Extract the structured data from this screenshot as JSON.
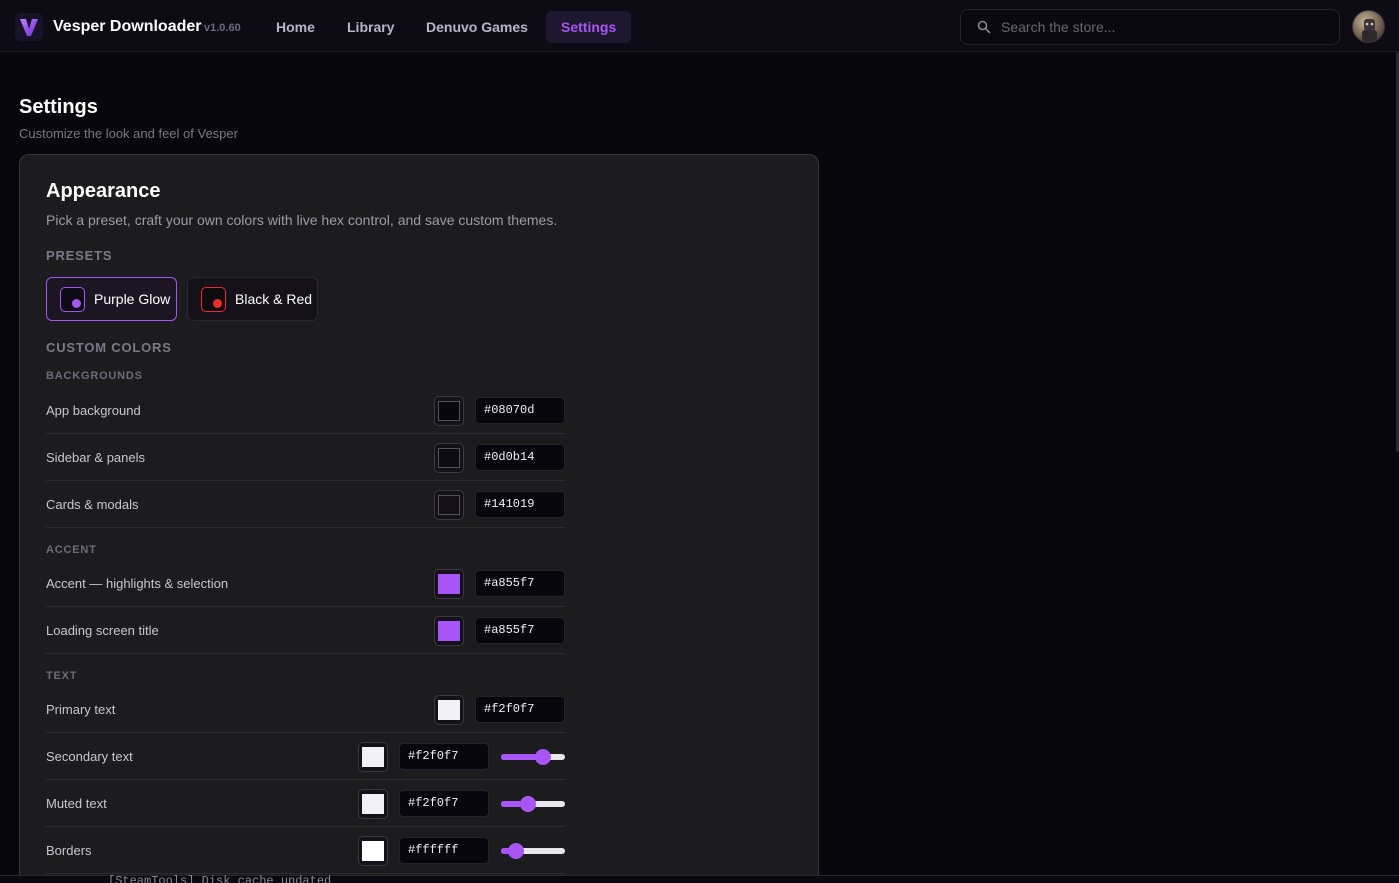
{
  "app": {
    "name": "Vesper Downloader",
    "version": "v1.0.60",
    "accent": "#a855f7"
  },
  "nav": {
    "items": [
      {
        "label": "Home",
        "active": false
      },
      {
        "label": "Library",
        "active": false
      },
      {
        "label": "Denuvo Games",
        "active": false
      },
      {
        "label": "Settings",
        "active": true
      }
    ]
  },
  "search": {
    "placeholder": "Search the store...",
    "icon": "search-icon"
  },
  "page": {
    "title": "Settings",
    "subtitle": "Customize the look and feel of Vesper"
  },
  "appearance": {
    "title": "Appearance",
    "description": "Pick a preset, craft your own colors with live hex control, and save custom themes.",
    "presets_label": "PRESETS",
    "presets": [
      {
        "label": "Purple Glow",
        "dot_color": "#a855f7",
        "active": true
      },
      {
        "label": "Black & Red",
        "dot_color": "#ef2b2b",
        "active": false
      }
    ],
    "custom_label": "CUSTOM COLORS",
    "groups": {
      "backgrounds": {
        "label": "BACKGROUNDS",
        "rows": [
          {
            "label": "App background",
            "hex": "#08070d"
          },
          {
            "label": "Sidebar & panels",
            "hex": "#0d0b14"
          },
          {
            "label": "Cards & modals",
            "hex": "#141019"
          }
        ]
      },
      "accent": {
        "label": "ACCENT",
        "rows": [
          {
            "label": "Accent — highlights & selection",
            "hex": "#a855f7"
          },
          {
            "label": "Loading screen title",
            "hex": "#a855f7"
          }
        ]
      },
      "text": {
        "label": "TEXT",
        "rows": [
          {
            "label": "Primary text",
            "hex": "#f2f0f7"
          },
          {
            "label": "Secondary text",
            "hex": "#f2f0f7",
            "opacity": 0.7
          },
          {
            "label": "Muted text",
            "hex": "#f2f0f7",
            "opacity": 0.4
          },
          {
            "label": "Borders",
            "hex": "#ffffff",
            "opacity": 0.15
          }
        ]
      }
    }
  },
  "console": {
    "line": "[SteamTools] Disk cache updated"
  }
}
